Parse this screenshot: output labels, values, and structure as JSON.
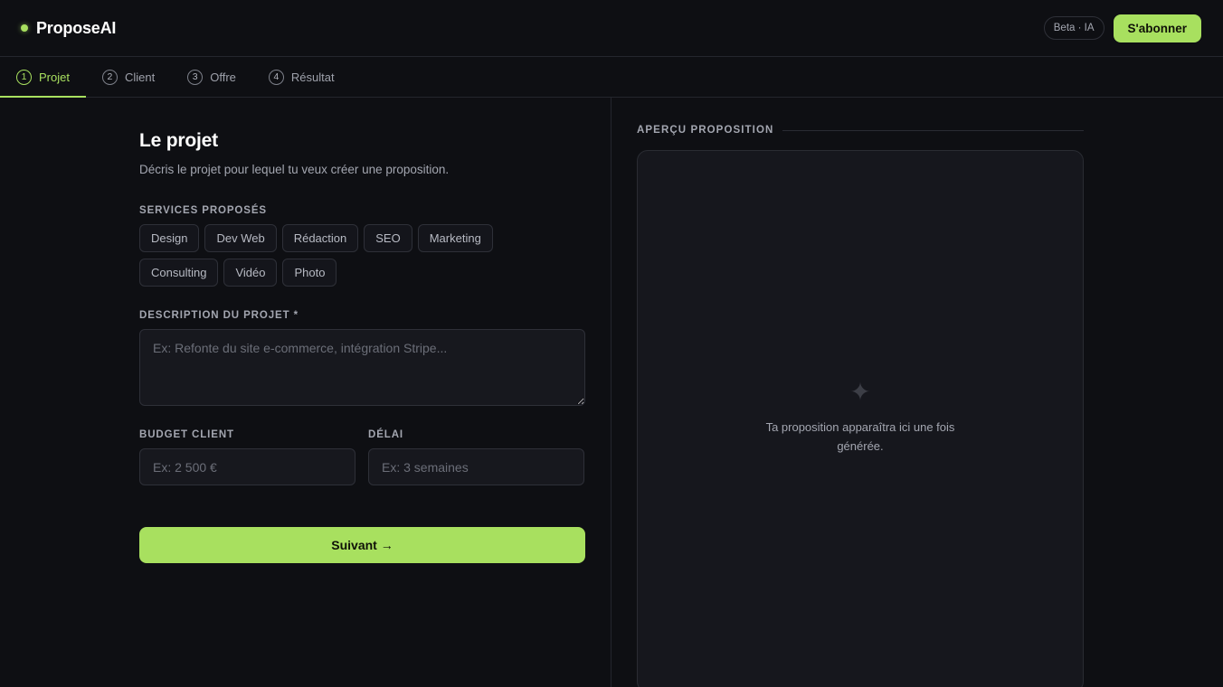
{
  "header": {
    "brand": "ProposeAI",
    "badge": "Beta · IA",
    "subscribe_label": "S'abonner"
  },
  "steps": [
    {
      "num": "1",
      "label": "Projet",
      "active": true
    },
    {
      "num": "2",
      "label": "Client",
      "active": false
    },
    {
      "num": "3",
      "label": "Offre",
      "active": false
    },
    {
      "num": "4",
      "label": "Résultat",
      "active": false
    }
  ],
  "form": {
    "title": "Le projet",
    "subtitle": "Décris le projet pour lequel tu veux créer une proposition.",
    "services_label": "SERVICES PROPOSÉS",
    "services": [
      "Design",
      "Dev Web",
      "Rédaction",
      "SEO",
      "Marketing",
      "Consulting",
      "Vidéo",
      "Photo"
    ],
    "description_label": "DESCRIPTION DU PROJET *",
    "description_placeholder": "Ex: Refonte du site e-commerce, intégration Stripe...",
    "description_value": "",
    "budget_label": "BUDGET CLIENT",
    "budget_placeholder": "Ex: 2 500 €",
    "budget_value": "",
    "delay_label": "DÉLAI",
    "delay_placeholder": "Ex: 3 semaines",
    "delay_value": "",
    "next_label": "Suivant →"
  },
  "preview": {
    "label": "APERÇU PROPOSITION",
    "icon": "sparkle-icon",
    "empty_text": "Ta proposition apparaîtra ici une fois générée."
  },
  "colors": {
    "accent": "#a8e05f",
    "background": "#0e0f13",
    "surface": "#17181e"
  }
}
